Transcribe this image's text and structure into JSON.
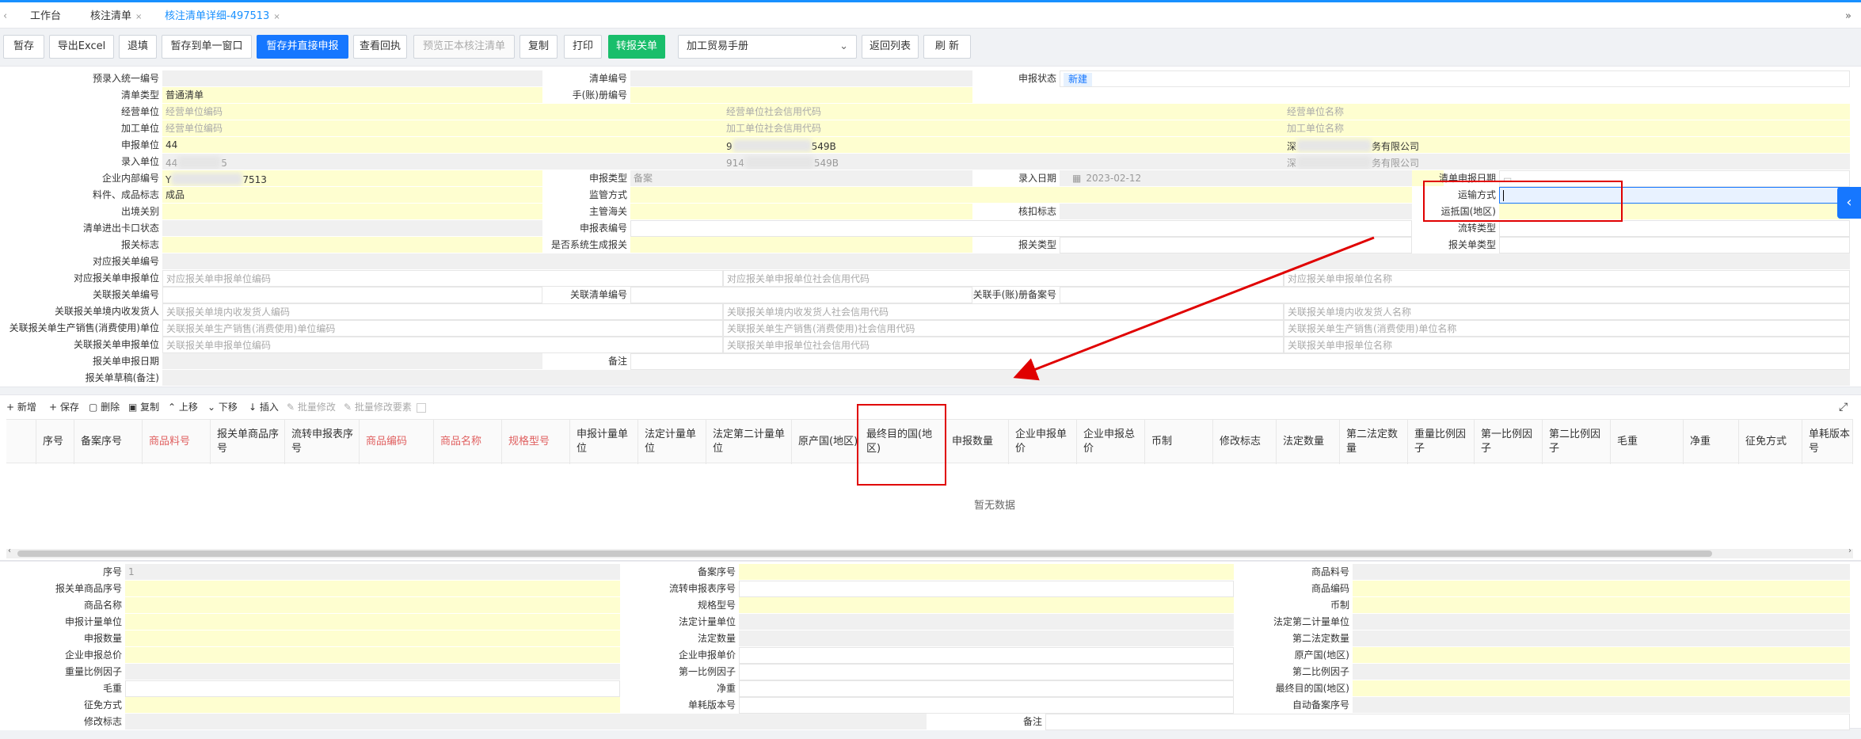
{
  "tabs": [
    {
      "label": "工作台"
    },
    {
      "label": "核注清单"
    },
    {
      "label": "核注清单详细-497513"
    }
  ],
  "toolbar": {
    "buttons": [
      "暂存",
      "导出Excel",
      "退填",
      "暂存到单一窗口",
      "暂存并直接申报",
      "查看回执",
      "预览正本核注清单",
      "复制",
      "打印",
      "转报关单"
    ],
    "select_value": "加工贸易手册",
    "buttons_right": [
      "返回列表",
      "刷 新"
    ]
  },
  "head": {
    "row1": {
      "l1": "预录入统一编号",
      "l2": "清单编号",
      "l3": "申报状态",
      "status": "新建"
    },
    "row2": {
      "l1": "清单类型",
      "v1": "普通清单",
      "l2": "手(账)册编号"
    },
    "row3": {
      "l1": "经营单位",
      "p1": "经营单位编码",
      "p2": "经营单位社会信用代码",
      "p3": "经营单位名称"
    },
    "row4": {
      "l1": "加工单位",
      "p1": "经营单位编码",
      "p2": "加工单位社会信用代码",
      "p3": "加工单位名称"
    },
    "row5": {
      "l1": "申报单位",
      "v1": "44",
      "v2a": "9",
      "v2b": "549B",
      "v3a": "深",
      "v3b": "务有限公司"
    },
    "row6": {
      "l1": "录入单位",
      "v1": "44",
      "v1b": "5",
      "v2a": "914",
      "v2b": "549B",
      "v3a": "深",
      "v3b": "务有限公司"
    },
    "row7": {
      "l1": "企业内部编号",
      "v1a": "Y",
      "v1b": "7513",
      "l2": "申报类型",
      "v2": "备案",
      "l3": "录入日期",
      "date": "2023-02-12",
      "l4": "清单申报日期"
    },
    "row8": {
      "l1": "料件、成品标志",
      "v1": "成品",
      "l2": "监管方式",
      "l4": "运输方式"
    },
    "row9": {
      "l1": "出境关别",
      "l2": "主管海关",
      "l3": "核扣标志",
      "l4": "运抵国(地区)"
    },
    "row10": {
      "l1": "清单进出卡口状态",
      "l2": "申报表编号",
      "l4": "流转类型"
    },
    "row11": {
      "l1": "报关标志",
      "l2": "是否系统生成报关",
      "l3": "报关类型",
      "l4": "报关单类型"
    },
    "row12": {
      "l1": "对应报关单编号"
    },
    "row13": {
      "l1": "对应报关单申报单位",
      "p1": "对应报关单申报单位编码",
      "p2": "对应报关单申报单位社会信用代码",
      "p3": "对应报关单申报单位名称"
    },
    "row14": {
      "l1": "关联报关单编号",
      "l2": "关联清单编号",
      "l3": "关联手(账)册备案号"
    },
    "row15": {
      "l1": "关联报关单境内收发货人",
      "p1": "关联报关单境内收发货人编码",
      "p2": "关联报关单境内收发货人社会信用代码",
      "p3": "关联报关单境内收发货人名称"
    },
    "row16": {
      "l1": "关联报关单生产销售(消费使用)单位",
      "p1": "关联报关单生产销售(消费使用)单位编码",
      "p2": "关联报关单生产销售(消费使用)社会信用代码",
      "p3": "关联报关单生产销售(消费使用)单位名称"
    },
    "row17": {
      "l1": "关联报关单申报单位",
      "p1": "关联报关单申报单位编码",
      "p2": "关联报关单申报单位社会信用代码",
      "p3": "关联报关单申报单位名称"
    },
    "row18": {
      "l1": "报关单申报日期",
      "l2": "备注"
    },
    "row19": {
      "l1": "报关单草稿(备注)"
    }
  },
  "grid": {
    "tools": [
      "+ 新增",
      "+ 保存",
      "删除",
      "复制",
      "上移",
      "下移",
      "插入",
      "批量修改",
      "批量修改要素"
    ],
    "columns": [
      "序号",
      "备案序号",
      "商品料号",
      "报关单商品序号",
      "流转申报表序号",
      "商品编码",
      "商品名称",
      "规格型号",
      "申报计量单位",
      "法定计量单位",
      "法定第二计量单位",
      "原产国(地区)",
      "最终目的国(地区)",
      "申报数量",
      "企业申报单价",
      "企业申报总价",
      "币制",
      "修改标志",
      "法定数量",
      "第二法定数量",
      "重量比例因子",
      "第一比例因子",
      "第二比例因子",
      "毛重",
      "净重",
      "征免方式",
      "单耗版本号"
    ],
    "empty": "暂无数据"
  },
  "detail": {
    "c1": [
      "序号",
      "报关单商品序号",
      "商品名称",
      "申报计量单位",
      "申报数量",
      "企业申报总价",
      "重量比例因子",
      "毛重",
      "征免方式",
      "修改标志"
    ],
    "seq_value": "1",
    "c2": [
      "备案序号",
      "流转申报表序号",
      "规格型号",
      "法定计量单位",
      "法定数量",
      "企业申报单价",
      "第一比例因子",
      "净重",
      "单耗版本号",
      "备注"
    ],
    "c3": [
      "商品料号",
      "商品编码",
      "币制",
      "法定第二计量单位",
      "第二法定数量",
      "原产国(地区)",
      "第二比例因子",
      "最终目的国(地区)",
      "自动备案序号"
    ]
  }
}
